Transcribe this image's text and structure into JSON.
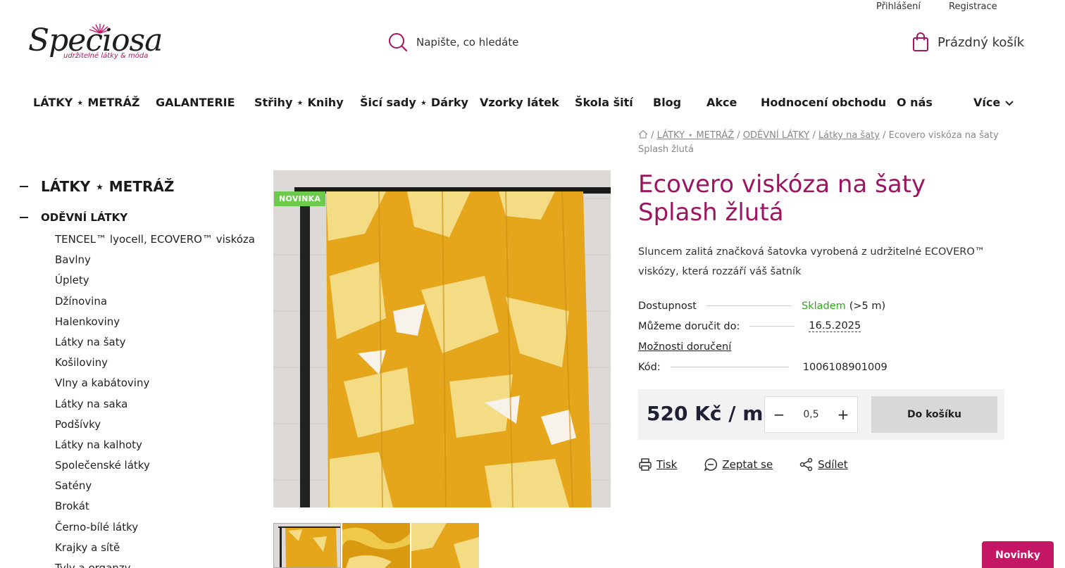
{
  "header": {
    "login": "Přihlášení",
    "register": "Registrace",
    "logo_text": "Speciosa",
    "logo_tagline": "udržitelné látky & móda",
    "search_placeholder": "Napište, co hledáte",
    "cart_label": "Prázdný košík"
  },
  "nav": {
    "items": [
      "LÁTKY ⋆ METRÁŽ",
      "GALANTERIE",
      "Střihy ⋆ Knihy",
      "Šicí sady ⋆ Dárky",
      "Vzorky látek",
      "Škola šití",
      "Blog",
      "Akce",
      "Hodnocení obchodu",
      "O nás",
      "Více"
    ]
  },
  "breadcrumb": {
    "sep": "/",
    "items": [
      "LÁTKY ⋆ METRÁŽ",
      "ODĚVNÍ LÁTKY",
      "Látky na šaty"
    ],
    "current": "Ecovero viskóza na šaty Splash žlutá"
  },
  "sidebar": {
    "title": "LÁTKY ⋆ METRÁŽ",
    "subtitle": "ODĚVNÍ LÁTKY",
    "items": [
      "TENCEL™ lyocell, ECOVERO™ viskóza",
      "Bavlny",
      "Úplety",
      "Džínovina",
      "Halenkoviny",
      "Látky na šaty",
      "Košiloviny",
      "Vlny a kabátoviny",
      "Látky na saka",
      "Podšívky",
      "Látky na kalhoty",
      "Společenské látky",
      "Satény",
      "Brokát",
      "Černo-bílé látky",
      "Krajky a sítě",
      "Tyly a organzy"
    ]
  },
  "product": {
    "badge": "NOVINKA",
    "title": "Ecovero viskóza na šaty Splash žlutá",
    "description": "Sluncem zalitá značková šatovka vyrobená z udržitelné ECOVERO™ viskózy, která rozzáří váš šatník",
    "availability_label": "Dostupnost",
    "availability_value": "Skladem",
    "availability_extra": "(>5 m)",
    "delivery_label": "Můžeme doručit do:",
    "delivery_value": "16.5.2025",
    "delivery_options": "Možnosti doručení",
    "code_label": "Kód:",
    "code_value": "1006108901009",
    "price": "520 Kč / m",
    "quantity": "0,5",
    "qty_minus": "−",
    "qty_plus": "+",
    "add_to_cart": "Do košíku",
    "actions": {
      "print": "Tisk",
      "ask": "Zeptat se",
      "share": "Sdílet"
    }
  },
  "newsletter_button": "Novinky",
  "colors": {
    "brand": "#9b1560",
    "accent_button": "#c51565",
    "stock_green": "#2eaa1a",
    "fabric_yellow": "#e6a61c"
  }
}
